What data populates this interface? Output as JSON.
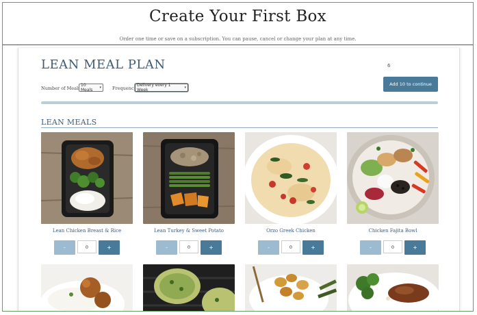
{
  "header": {
    "title": "Create Your First Box",
    "subtitle": "Order one time or save on a subscription. You can pause, cancel or change your plan at any time."
  },
  "plan": {
    "title": "LEAN MEAL PLAN",
    "cart_count": "6",
    "continue_label": "Add 10 to continue",
    "meals_label": "Number of Meals",
    "meals_value": "10 Meals",
    "frequency_label": "Frequency",
    "frequency_value": "Delivery every 1 Week",
    "progress_fraction": 0
  },
  "section": {
    "title": "LEAN MEALS"
  },
  "meals": [
    {
      "name": "Lean Chicken Breast & Rice",
      "minus": "-",
      "qty": "0",
      "plus": "+"
    },
    {
      "name": "Lean Turkey & Sweet Potato",
      "minus": "-",
      "qty": "0",
      "plus": "+"
    },
    {
      "name": "Orzo Greek Chicken",
      "minus": "-",
      "qty": "0",
      "plus": "+"
    },
    {
      "name": "Chicken Fajita Bowl",
      "minus": "-",
      "qty": "0",
      "plus": "+"
    }
  ],
  "colors": {
    "accent": "#4a7a9a",
    "accent_light": "#9cbbd0",
    "heading": "#3b5c7a"
  }
}
